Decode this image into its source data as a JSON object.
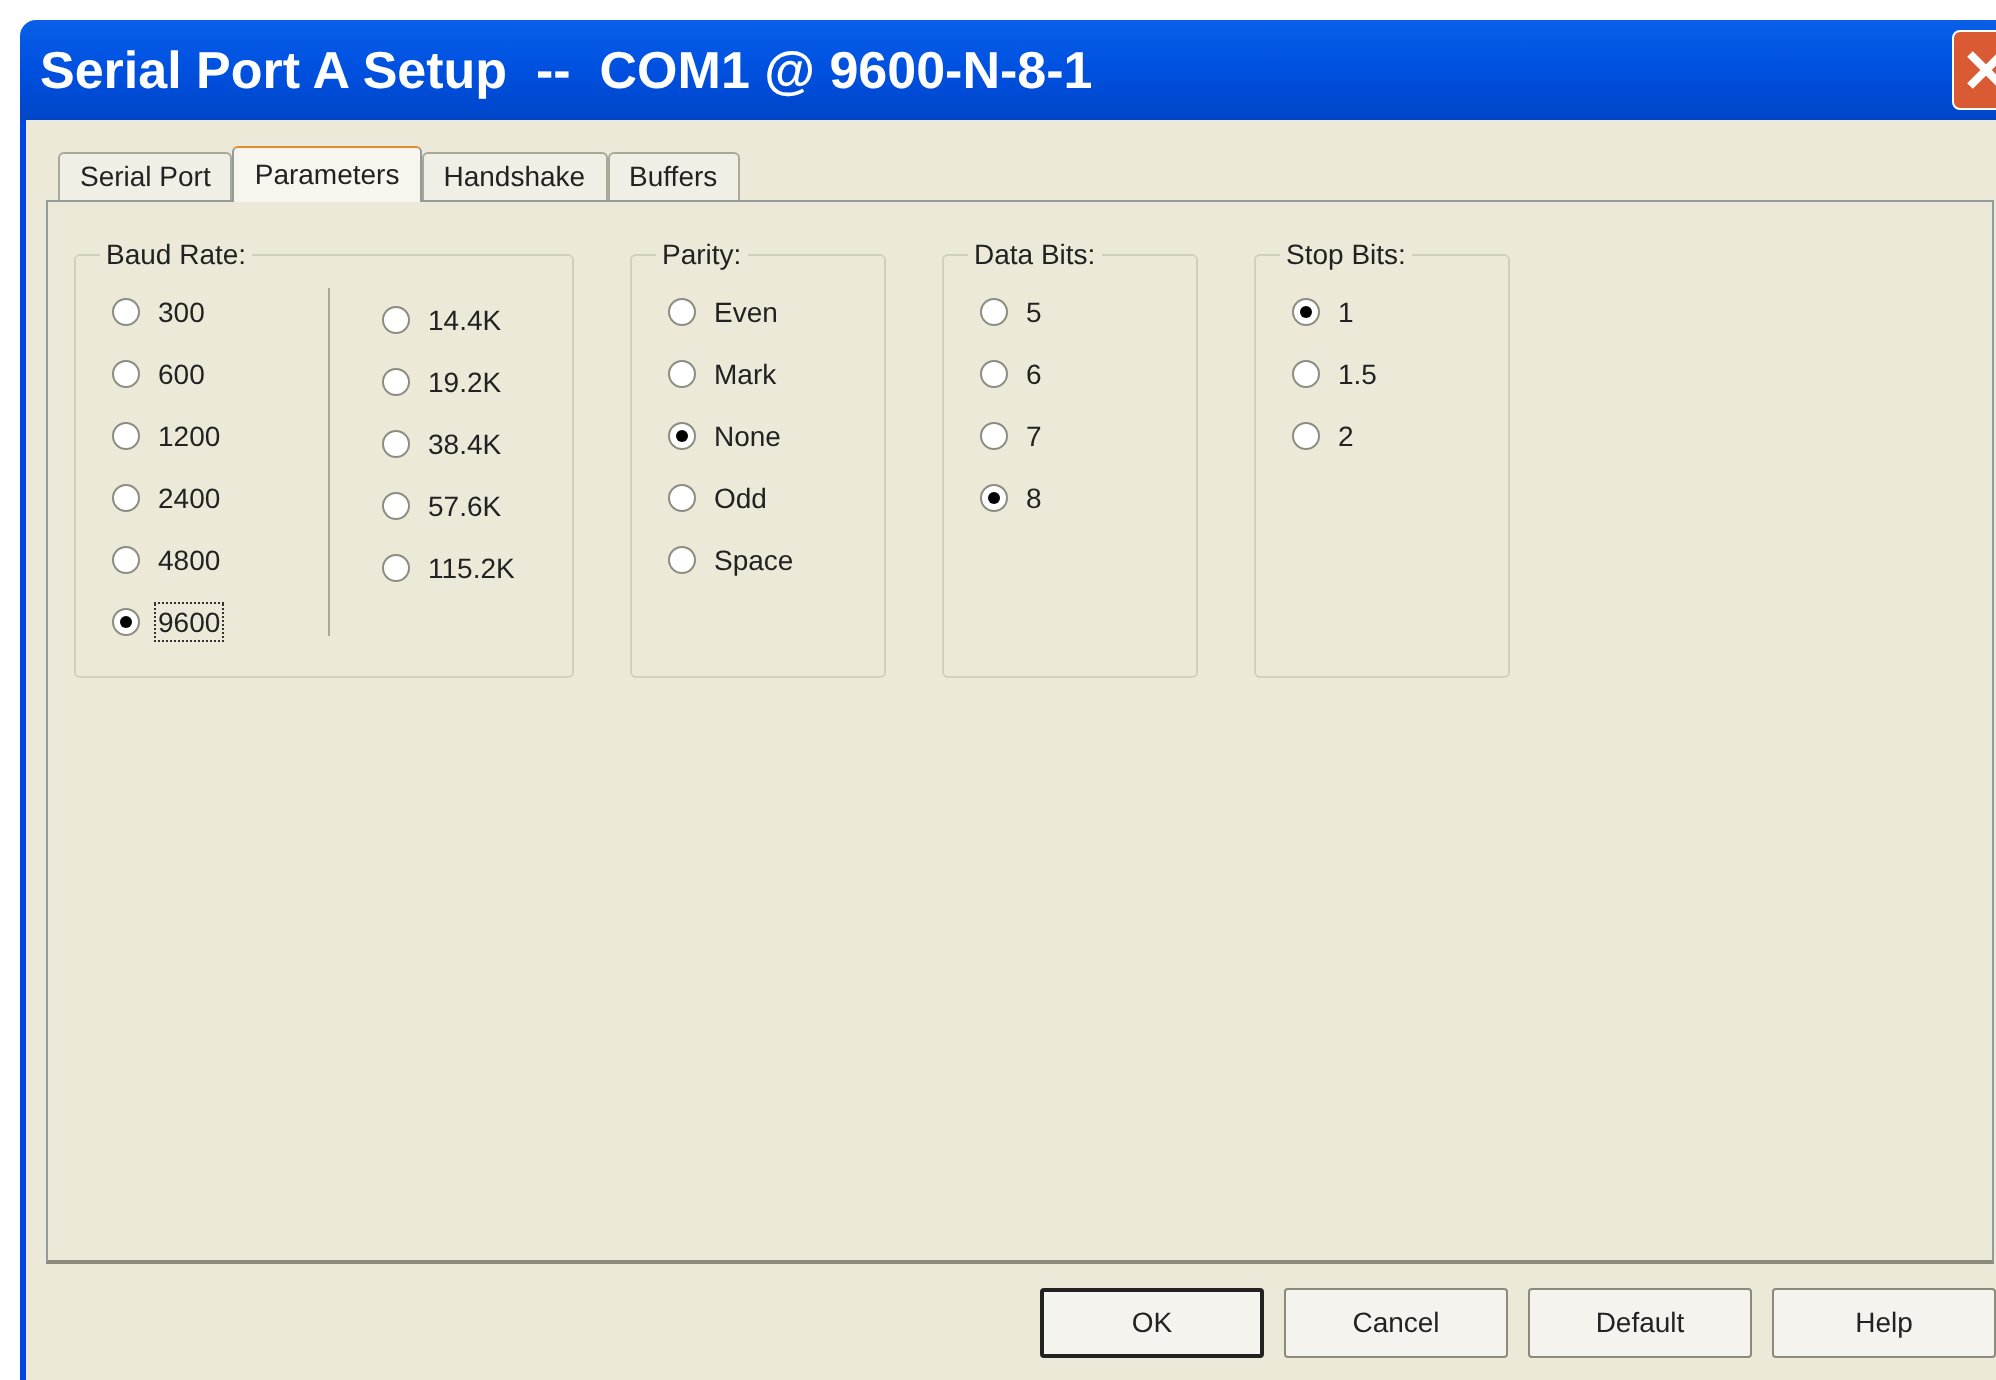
{
  "window": {
    "title": "Serial Port A Setup  --  COM1 @ 9600-N-8-1"
  },
  "tabs": [
    {
      "label": "Serial Port",
      "selected": false
    },
    {
      "label": "Parameters",
      "selected": true
    },
    {
      "label": "Handshake",
      "selected": false
    },
    {
      "label": "Buffers",
      "selected": false
    }
  ],
  "groups": [
    {
      "title": "Baud Rate:",
      "columns": [
        [
          {
            "label": "300",
            "selected": false,
            "focused": false
          },
          {
            "label": "600",
            "selected": false,
            "focused": false
          },
          {
            "label": "1200",
            "selected": false,
            "focused": false
          },
          {
            "label": "2400",
            "selected": false,
            "focused": false
          },
          {
            "label": "4800",
            "selected": false,
            "focused": false
          },
          {
            "label": "9600",
            "selected": true,
            "focused": true
          }
        ],
        [
          {
            "label": "14.4K",
            "selected": false,
            "focused": false
          },
          {
            "label": "19.2K",
            "selected": false,
            "focused": false
          },
          {
            "label": "38.4K",
            "selected": false,
            "focused": false
          },
          {
            "label": "57.6K",
            "selected": false,
            "focused": false
          },
          {
            "label": "115.2K",
            "selected": false,
            "focused": false
          }
        ]
      ]
    },
    {
      "title": "Parity:",
      "columns": [
        [
          {
            "label": "Even",
            "selected": false,
            "focused": false
          },
          {
            "label": "Mark",
            "selected": false,
            "focused": false
          },
          {
            "label": "None",
            "selected": true,
            "focused": false
          },
          {
            "label": "Odd",
            "selected": false,
            "focused": false
          },
          {
            "label": "Space",
            "selected": false,
            "focused": false
          }
        ]
      ]
    },
    {
      "title": "Data Bits:",
      "columns": [
        [
          {
            "label": "5",
            "selected": false,
            "focused": false
          },
          {
            "label": "6",
            "selected": false,
            "focused": false
          },
          {
            "label": "7",
            "selected": false,
            "focused": false
          },
          {
            "label": "8",
            "selected": true,
            "focused": false
          }
        ]
      ]
    },
    {
      "title": "Stop Bits:",
      "columns": [
        [
          {
            "label": "1",
            "selected": true,
            "focused": false
          },
          {
            "label": "1.5",
            "selected": false,
            "focused": false
          },
          {
            "label": "2",
            "selected": false,
            "focused": false
          }
        ]
      ]
    }
  ],
  "buttons": [
    {
      "label": "OK",
      "default": true
    },
    {
      "label": "Cancel",
      "default": false
    },
    {
      "label": "Default",
      "default": false
    },
    {
      "label": "Help",
      "default": false
    }
  ]
}
